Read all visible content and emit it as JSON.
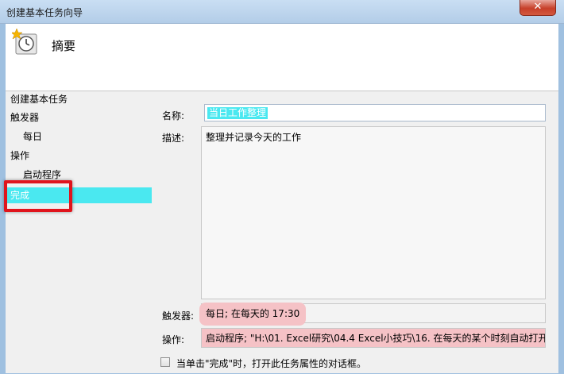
{
  "window": {
    "title": "创建基本任务向导",
    "close_glyph": "✕"
  },
  "header": {
    "title": "摘要",
    "icon": "task-scheduler-clock-icon"
  },
  "nav": {
    "items": [
      {
        "label": "创建基本任务",
        "indent": false,
        "selected": false
      },
      {
        "label": "触发器",
        "indent": false,
        "selected": false
      },
      {
        "label": "每日",
        "indent": true,
        "selected": false
      },
      {
        "label": "操作",
        "indent": false,
        "selected": false
      },
      {
        "label": "启动程序",
        "indent": true,
        "selected": false
      },
      {
        "label": "完成",
        "indent": false,
        "selected": true
      }
    ]
  },
  "form": {
    "name_label": "名称:",
    "name_value": "当日工作整理",
    "desc_label": "描述:",
    "desc_value": "整理并记录今天的工作",
    "trigger_label": "触发器:",
    "trigger_value": "每日; 在每天的 17:30",
    "action_label": "操作:",
    "action_value": "启动程序; \"H:\\01. Excel研究\\04.4 Excel小技巧\\16. 在每天的某个时刻自动打开特",
    "open_props_label": "当单击\"完成\"时，打开此任务属性的对话框。",
    "open_props_checked": false
  },
  "colors": {
    "selection": "#4ae8f0",
    "annotation_box": "#e0141c",
    "annotation_pill": "#f5c2c6"
  }
}
